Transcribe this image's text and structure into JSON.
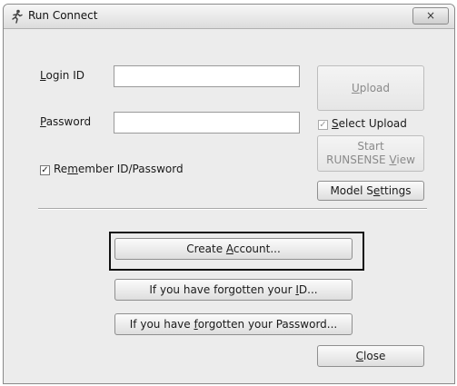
{
  "window": {
    "title": "Run Connect",
    "close_glyph": "×"
  },
  "form": {
    "login_id_label_ul": "L",
    "login_id_label_rest": "ogin ID",
    "login_id_value": "",
    "password_label_ul": "P",
    "password_label_rest": "assword",
    "password_value": "",
    "remember_pre": "Re",
    "remember_ul": "m",
    "remember_rest": "ember ID/Password",
    "remember_checked": true
  },
  "side": {
    "upload_ul": "U",
    "upload_rest": "pload",
    "select_upload_ul": "S",
    "select_upload_rest": "elect Upload",
    "select_upload_checked": true,
    "start_line1": "Start",
    "start_line2_pre": "RUNSENSE ",
    "start_line2_ul": "V",
    "start_line2_rest": "iew",
    "model_settings_pre": "Model S",
    "model_settings_ul": "e",
    "model_settings_rest": "ttings"
  },
  "actions": {
    "create_pre": "Create ",
    "create_ul": "A",
    "create_rest": "ccount...",
    "forgot_id_pre": "If you have forgotten your ",
    "forgot_id_ul": "I",
    "forgot_id_rest": "D...",
    "forgot_pw_pre": "If you have ",
    "forgot_pw_ul": "f",
    "forgot_pw_rest": "orgotten your Password...",
    "close_ul": "C",
    "close_rest": "lose"
  },
  "icons": {
    "app": "runner-icon",
    "close": "close-icon",
    "check": "✓"
  }
}
